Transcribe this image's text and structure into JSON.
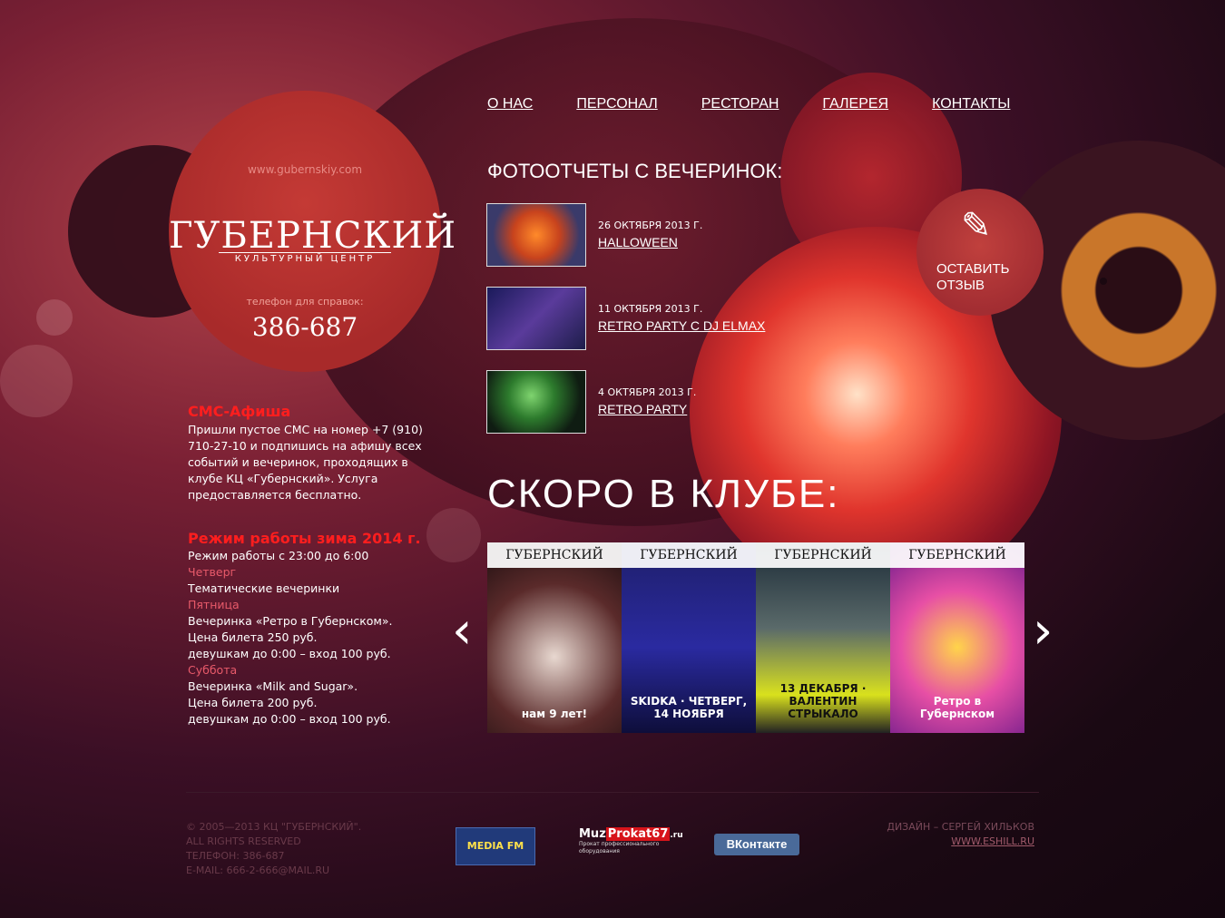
{
  "site": {
    "url": "www.gubernskiy.com",
    "logo_name": "ГУБЕРНСКИЙ",
    "logo_sub": "КУЛЬТУРНЫЙ ЦЕНТР",
    "phone_label": "телефон для справок:",
    "phone": "386-687"
  },
  "nav": [
    "О НАС",
    "ПЕРСОНАЛ",
    "РЕСТОРАН",
    "ГАЛЕРЕЯ",
    "КОНТАКТЫ"
  ],
  "reports": {
    "title": "ФОТООТЧЕТЫ С ВЕЧЕРИНОК:",
    "items": [
      {
        "date": "26 ОКТЯБРЯ 2013 Г.",
        "title": "HALLOWEEN"
      },
      {
        "date": "11 ОКТЯБРЯ 2013 Г.",
        "title": "RETRO PARTY C DJ ELMAX"
      },
      {
        "date": "4 ОКТЯБРЯ 2013 Г.",
        "title": "RETRO PARTY"
      }
    ]
  },
  "review_button": {
    "label": "ОСТАВИТЬ ОТЗЫВ",
    "icon": "pen-icon"
  },
  "soon": {
    "title": "СКОРО В КЛУБЕ:",
    "posters": [
      {
        "header": "ГУБЕРНСКИЙ",
        "text": "нам 9 лет!"
      },
      {
        "header": "ГУБЕРНСКИЙ",
        "text": "SKIDKA · ЧЕТВЕРГ, 14 НОЯБРЯ"
      },
      {
        "header": "ГУБЕРНСКИЙ",
        "text": "13 ДЕКАБРЯ · ВАЛЕНТИН СТРЫКАЛО"
      },
      {
        "header": "ГУБЕРНСКИЙ",
        "text": "Ретро в Губернском"
      }
    ]
  },
  "sms": {
    "title": "СМС-Афиша",
    "text": "Пришли пустое СМС на номер +7 (910) 710-27-10 и подпишись на афишу всех событий и вечеринок, проходящих в клубе КЦ «Губернский». Услуга предоставляется бесплатно."
  },
  "hours": {
    "title": "Режим работы зима 2014 г.",
    "general": "Режим работы с 23:00 до 6:00",
    "days": [
      {
        "day": "Четверг",
        "lines": [
          "Тематические вечеринки"
        ]
      },
      {
        "day": "Пятница",
        "lines": [
          "Вечеринка «Ретро в Губернском».",
          "Цена билета 250 руб.",
          "девушкам до 0:00 – вход 100 руб."
        ]
      },
      {
        "day": "Суббота",
        "lines": [
          "Вечеринка «Milk and Sugar».",
          "Цена билета 200 руб.",
          "девушкам до 0:00 – вход 100 руб."
        ]
      }
    ]
  },
  "footer": {
    "left": [
      "© 2005—2013 КЦ \"ГУБЕРНСКИЙ\".",
      "ALL RIGHTS RESERVED",
      "ТЕЛЕФОН: 386-687",
      "E-MAIL: 666-2-666@MAIL.RU"
    ],
    "design": "ДИЗАЙН – СЕРГЕЙ ХИЛЬКОВ",
    "design_link": "WWW.ESHILL.RU",
    "partners": {
      "media": "MEDIA FM",
      "prokat_muz": "Muz",
      "prokat_name": "Prokat67",
      "prokat_tld": ".ru",
      "prokat_sub": "Прокат профессионального оборудования",
      "vk": "ВКонтакте"
    }
  }
}
